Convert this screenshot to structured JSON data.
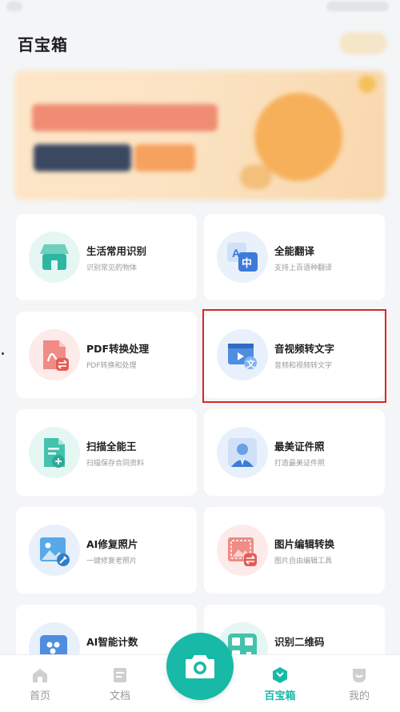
{
  "header": {
    "title": "百宝箱"
  },
  "tools": [
    {
      "title": "生活常用识别",
      "subtitle": "识别常见的物体",
      "icon": "store-icon"
    },
    {
      "title": "全能翻译",
      "subtitle": "支持上百语种翻译",
      "icon": "translate-icon"
    },
    {
      "title": "PDF转换处理",
      "subtitle": "PDF转换和处理",
      "icon": "pdf-icon"
    },
    {
      "title": "音视频转文字",
      "subtitle": "音频和视频转文字",
      "icon": "video-text-icon"
    },
    {
      "title": "扫描全能王",
      "subtitle": "扫描保存合同资料",
      "icon": "scan-document-icon"
    },
    {
      "title": "最美证件照",
      "subtitle": "打造最美证件照",
      "icon": "id-photo-icon"
    },
    {
      "title": "AI修复照片",
      "subtitle": "一键修复老照片",
      "icon": "photo-repair-icon"
    },
    {
      "title": "图片编辑转换",
      "subtitle": "图片自由编辑工具",
      "icon": "image-edit-icon"
    },
    {
      "title": "AI智能计数",
      "subtitle": "",
      "icon": "counting-icon"
    },
    {
      "title": "识别二维码",
      "subtitle": "",
      "icon": "qr-code-icon"
    }
  ],
  "tab_bar": {
    "tabs": [
      {
        "label": "首页",
        "icon": "home-icon"
      },
      {
        "label": "文档",
        "icon": "document-icon"
      },
      {
        "label": "百宝箱",
        "icon": "toolbox-icon"
      },
      {
        "label": "我的",
        "icon": "profile-icon"
      }
    ],
    "active_tab": "百宝箱",
    "center_action_icon": "camera-icon"
  },
  "colors": {
    "accent": "#19b9a7",
    "highlight_border": "#d92727",
    "background": "#f4f5f7"
  }
}
